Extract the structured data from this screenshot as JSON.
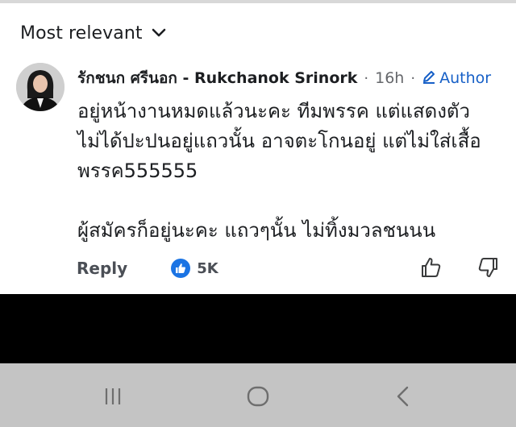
{
  "sort": {
    "label": "Most relevant",
    "icon": "chevron-down-icon"
  },
  "comment": {
    "author": "รักชนก ศรีนอก - Rukchanok Srinork",
    "separator": "·",
    "time": "16h",
    "author_badge_label": "Author",
    "author_badge_icon": "pencil-icon",
    "body_lines": [
      "อยู่หน้างานหมดแล้วนะคะ ทีมพรรค แต่แสดงตัว",
      "ไม่ได้ปะปนอยู่แถวนั้น อาจตะโกนอยู่ แต่ไม่ใส่เสื้อ",
      "พรรค555555",
      "",
      "ผู้สมัครก็อยู่นะคะ แถวๆนั้น ไม่ทิ้งมวลชนนน"
    ],
    "reply_label": "Reply",
    "reaction_icon": "like-icon",
    "reaction_count": "5K",
    "upvote_icon": "thumbs-up-outline-icon",
    "downvote_icon": "thumbs-down-outline-icon"
  },
  "navbar": {
    "recent_icon": "recent-apps-icon",
    "home_icon": "home-icon",
    "back_icon": "back-icon"
  },
  "colors": {
    "accent": "#1760c7",
    "like_badge": "#1b74e4",
    "navbar_bg": "#c4c4c4",
    "band": "#000000"
  }
}
